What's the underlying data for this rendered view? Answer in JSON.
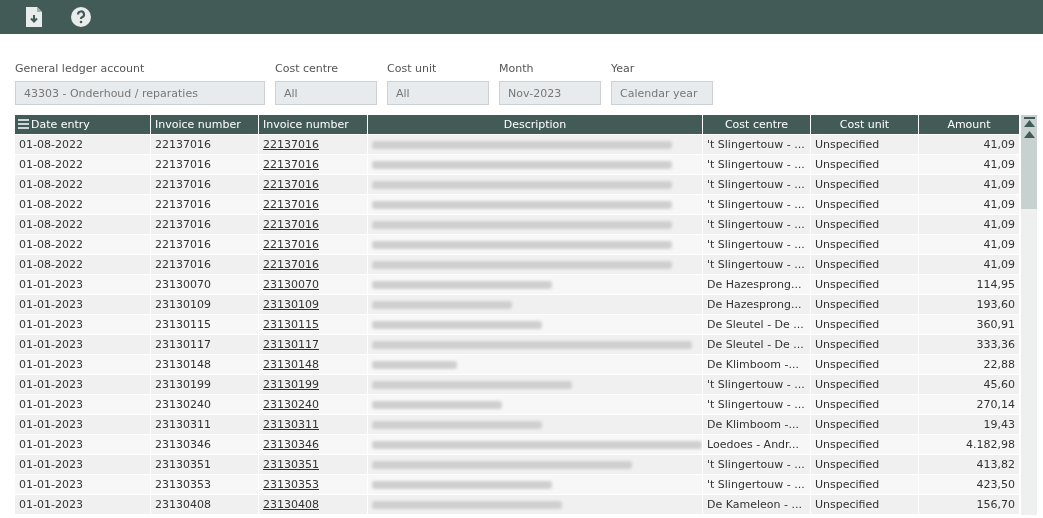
{
  "toolbar": {
    "buttons": [
      {
        "kind": "export"
      },
      {
        "kind": "help"
      }
    ]
  },
  "filters": [
    {
      "label": "General ledger account",
      "value": "43303 - Onderhoud / reparaties"
    },
    {
      "label": "Cost centre",
      "value": "All"
    },
    {
      "label": "Cost unit",
      "value": "All"
    },
    {
      "label": "Month",
      "value": "Nov-2023"
    },
    {
      "label": "Year",
      "value": "Calendar year"
    }
  ],
  "table": {
    "columns": [
      {
        "label": "Date entry"
      },
      {
        "label": "Invoice number"
      },
      {
        "label": "Invoice number"
      },
      {
        "label": "Description"
      },
      {
        "label": "Cost centre"
      },
      {
        "label": "Cost unit"
      },
      {
        "label": "Amount"
      }
    ],
    "rows": [
      {
        "date": "01-08-2022",
        "invoice": "22137016",
        "invoice_link": "22137016",
        "cost_centre": "'t Slingertouw - ...",
        "cost_unit": "Unspecified",
        "amount": "41,09"
      },
      {
        "date": "01-08-2022",
        "invoice": "22137016",
        "invoice_link": "22137016",
        "cost_centre": "'t Slingertouw - ...",
        "cost_unit": "Unspecified",
        "amount": "41,09"
      },
      {
        "date": "01-08-2022",
        "invoice": "22137016",
        "invoice_link": "22137016",
        "cost_centre": "'t Slingertouw - ...",
        "cost_unit": "Unspecified",
        "amount": "41,09"
      },
      {
        "date": "01-08-2022",
        "invoice": "22137016",
        "invoice_link": "22137016",
        "cost_centre": "'t Slingertouw - ...",
        "cost_unit": "Unspecified",
        "amount": "41,09"
      },
      {
        "date": "01-08-2022",
        "invoice": "22137016",
        "invoice_link": "22137016",
        "cost_centre": "'t Slingertouw - ...",
        "cost_unit": "Unspecified",
        "amount": "41,09"
      },
      {
        "date": "01-08-2022",
        "invoice": "22137016",
        "invoice_link": "22137016",
        "cost_centre": "'t Slingertouw - ...",
        "cost_unit": "Unspecified",
        "amount": "41,09"
      },
      {
        "date": "01-08-2022",
        "invoice": "22137016",
        "invoice_link": "22137016",
        "cost_centre": "'t Slingertouw - ...",
        "cost_unit": "Unspecified",
        "amount": "41,09"
      },
      {
        "date": "01-01-2023",
        "invoice": "23130070",
        "invoice_link": "23130070",
        "cost_centre": "De Hazesprong...",
        "cost_unit": "Unspecified",
        "amount": "114,95"
      },
      {
        "date": "01-01-2023",
        "invoice": "23130109",
        "invoice_link": "23130109",
        "cost_centre": "De Hazesprong...",
        "cost_unit": "Unspecified",
        "amount": "193,60"
      },
      {
        "date": "01-01-2023",
        "invoice": "23130115",
        "invoice_link": "23130115",
        "cost_centre": "De Sleutel - De ...",
        "cost_unit": "Unspecified",
        "amount": "360,91"
      },
      {
        "date": "01-01-2023",
        "invoice": "23130117",
        "invoice_link": "23130117",
        "cost_centre": "De Sleutel - De ...",
        "cost_unit": "Unspecified",
        "amount": "333,36"
      },
      {
        "date": "01-01-2023",
        "invoice": "23130148",
        "invoice_link": "23130148",
        "cost_centre": "De Klimboom -...",
        "cost_unit": "Unspecified",
        "amount": "22,88"
      },
      {
        "date": "01-01-2023",
        "invoice": "23130199",
        "invoice_link": "23130199",
        "cost_centre": "'t Slingertouw - ...",
        "cost_unit": "Unspecified",
        "amount": "45,60"
      },
      {
        "date": "01-01-2023",
        "invoice": "23130240",
        "invoice_link": "23130240",
        "cost_centre": "'t Slingertouw - ...",
        "cost_unit": "Unspecified",
        "amount": "270,14"
      },
      {
        "date": "01-01-2023",
        "invoice": "23130311",
        "invoice_link": "23130311",
        "cost_centre": "De Klimboom -...",
        "cost_unit": "Unspecified",
        "amount": "19,43"
      },
      {
        "date": "01-01-2023",
        "invoice": "23130346",
        "invoice_link": "23130346",
        "cost_centre": "Loedoes - Andr...",
        "cost_unit": "Unspecified",
        "amount": "4.182,98"
      },
      {
        "date": "01-01-2023",
        "invoice": "23130351",
        "invoice_link": "23130351",
        "cost_centre": "'t Slingertouw - ...",
        "cost_unit": "Unspecified",
        "amount": "413,82"
      },
      {
        "date": "01-01-2023",
        "invoice": "23130353",
        "invoice_link": "23130353",
        "cost_centre": "'t Slingertouw - ...",
        "cost_unit": "Unspecified",
        "amount": "423,50"
      },
      {
        "date": "01-01-2023",
        "invoice": "23130408",
        "invoice_link": "23130408",
        "cost_centre": "De Kameleon - ...",
        "cost_unit": "Unspecified",
        "amount": "156,70"
      }
    ]
  }
}
